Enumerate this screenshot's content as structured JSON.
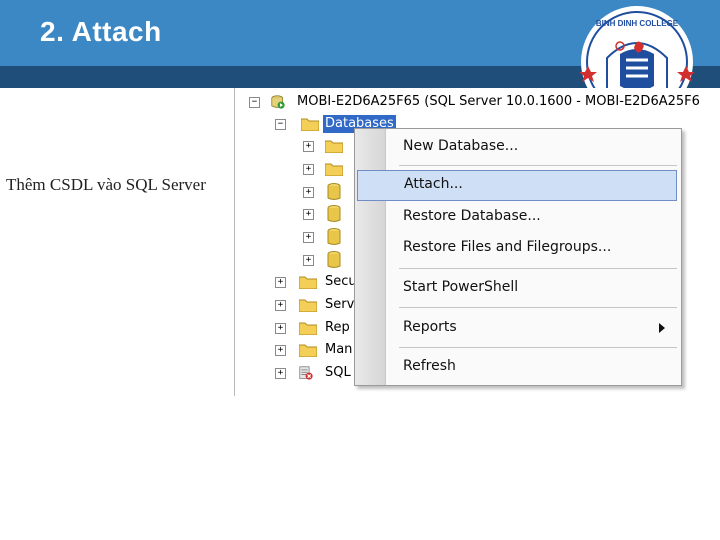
{
  "slide": {
    "title": "2. Attach",
    "caption": "Thêm CSDL vào SQL Server",
    "logo_text": "BINH DINH COLLEGE"
  },
  "colors": {
    "header_blue": "#3c88c5",
    "header_dark": "#1f4e7a",
    "selection_blue": "#3169c6",
    "menu_highlight": "#cfe0f6"
  },
  "tree": {
    "server": "MOBI-E2D6A25F65 (SQL Server 10.0.1600 - MOBI-E2D6A25F6",
    "databases": "Databases",
    "security": "Secu",
    "server_objects": "Serv",
    "replication": "Rep",
    "management": "Man",
    "sql_agent": "SQL"
  },
  "context_menu": {
    "items": [
      {
        "label": "New Database..."
      },
      {
        "label": "Attach..."
      },
      {
        "label": "Restore Database..."
      },
      {
        "label": "Restore Files and Filegroups..."
      },
      {
        "label": "Start PowerShell"
      },
      {
        "label": "Reports"
      },
      {
        "label": "Refresh"
      }
    ],
    "highlighted": "Attach..."
  }
}
